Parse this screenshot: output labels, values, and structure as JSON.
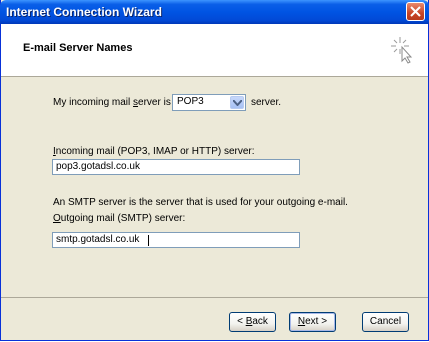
{
  "window": {
    "title": "Internet Connection Wizard"
  },
  "header": {
    "title": "E-mail Server Names",
    "icon": "wizard-cursor-icon"
  },
  "form": {
    "incoming_type_prefix": "My incoming mail ",
    "incoming_type_accel": "s",
    "incoming_type_suffix": "erver is a",
    "server_type_value": "POP3",
    "server_suffix": "server.",
    "incoming_server_accel": "I",
    "incoming_server_label_rest": "ncoming mail (POP3, IMAP or HTTP) server:",
    "incoming_server_value": "pop3.gotadsl.co.uk",
    "smtp_info": "An SMTP server is the server that is used for your outgoing e-mail.",
    "outgoing_server_accel": "O",
    "outgoing_server_label_rest": "utgoing mail (SMTP) server:",
    "outgoing_server_value": "smtp.gotadsl.co.uk"
  },
  "buttons": {
    "back_prefix": "< ",
    "back_accel": "B",
    "back_rest": "ack",
    "next_accel": "N",
    "next_rest": "ext >",
    "cancel": "Cancel"
  }
}
